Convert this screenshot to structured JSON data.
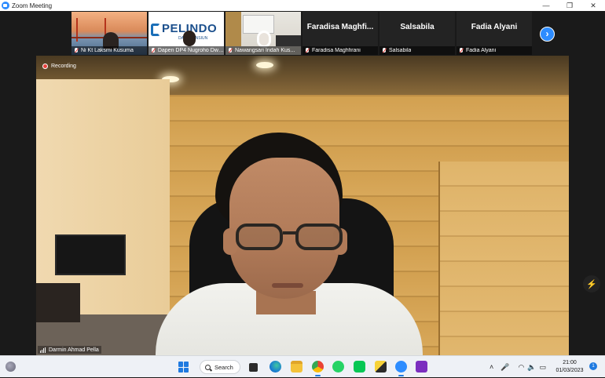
{
  "window": {
    "title": "Zoom Meeting",
    "minimize": "—",
    "maximize": "❐",
    "close": "✕"
  },
  "gallery": {
    "tiles": [
      {
        "name": "Ni Kt Laksmi Kusuma",
        "muted": true,
        "video": true
      },
      {
        "name": "Dapen DP4 Nugroho Dwi ...",
        "muted": true,
        "video": true,
        "logo_text": "PELINDO",
        "logo_sub": "DANA PENSIUN"
      },
      {
        "name": "Nawangsari Indah Kus...",
        "muted": true,
        "video": true
      },
      {
        "name": "Faradisa Maghfirani",
        "display_name": "Faradisa Maghfi...",
        "muted": true,
        "video": false
      },
      {
        "name": "Salsabila",
        "display_name": "Salsabila",
        "muted": true,
        "video": false
      },
      {
        "name": "Fadia Alyani",
        "display_name": "Fadia Alyani",
        "muted": true,
        "video": false
      }
    ],
    "next_icon": "chevron-right"
  },
  "main_video": {
    "recording_label": "Recording",
    "speaker_name": "Darmin Ahmad Pella"
  },
  "taskbar": {
    "search_label": "Search",
    "clock_time": "21:00",
    "clock_date": "01/03/2023",
    "notification_count": "1",
    "colors": {
      "accent": "#1f7ae0",
      "zoom_blue": "#2d8cff",
      "mute_red": "#e8413c"
    }
  }
}
